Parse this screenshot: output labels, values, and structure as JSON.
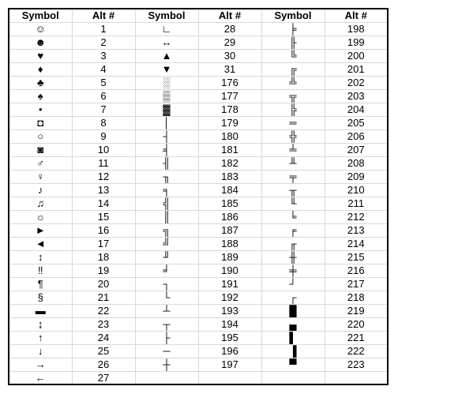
{
  "headers": [
    "Symbol",
    "Alt #",
    "Symbol",
    "Alt #",
    "Symbol",
    "Alt #"
  ],
  "columns": [
    [
      {
        "sym": "☺",
        "alt": "1"
      },
      {
        "sym": "☻",
        "alt": "2"
      },
      {
        "sym": "♥",
        "alt": "3"
      },
      {
        "sym": "♦",
        "alt": "4"
      },
      {
        "sym": "♣",
        "alt": "5"
      },
      {
        "sym": "♠",
        "alt": "6"
      },
      {
        "sym": "•",
        "alt": "7"
      },
      {
        "sym": "◘",
        "alt": "8"
      },
      {
        "sym": "○",
        "alt": "9"
      },
      {
        "sym": "◙",
        "alt": "10"
      },
      {
        "sym": "♂",
        "alt": "11"
      },
      {
        "sym": "♀",
        "alt": "12"
      },
      {
        "sym": "♪",
        "alt": "13"
      },
      {
        "sym": "♫",
        "alt": "14"
      },
      {
        "sym": "☼",
        "alt": "15"
      },
      {
        "sym": "►",
        "alt": "16"
      },
      {
        "sym": "◄",
        "alt": "17"
      },
      {
        "sym": "↕",
        "alt": "18"
      },
      {
        "sym": "‼",
        "alt": "19"
      },
      {
        "sym": "¶",
        "alt": "20"
      },
      {
        "sym": "§",
        "alt": "21"
      },
      {
        "sym": "▬",
        "alt": "22"
      },
      {
        "sym": "↨",
        "alt": "23"
      },
      {
        "sym": "↑",
        "alt": "24"
      },
      {
        "sym": "↓",
        "alt": "25"
      },
      {
        "sym": "→",
        "alt": "26"
      },
      {
        "sym": "←",
        "alt": "27"
      }
    ],
    [
      {
        "sym": "∟",
        "alt": "28"
      },
      {
        "sym": "↔",
        "alt": "29"
      },
      {
        "sym": "▲",
        "alt": "30"
      },
      {
        "sym": "▼",
        "alt": "31"
      },
      {
        "sym": "░",
        "alt": "176"
      },
      {
        "sym": "▒",
        "alt": "177"
      },
      {
        "sym": "▓",
        "alt": "178"
      },
      {
        "sym": "│",
        "alt": "179"
      },
      {
        "sym": "┤",
        "alt": "180"
      },
      {
        "sym": "╡",
        "alt": "181"
      },
      {
        "sym": "╢",
        "alt": "182"
      },
      {
        "sym": "╖",
        "alt": "183"
      },
      {
        "sym": "╕",
        "alt": "184"
      },
      {
        "sym": "╣",
        "alt": "185"
      },
      {
        "sym": "║",
        "alt": "186"
      },
      {
        "sym": "╗",
        "alt": "187"
      },
      {
        "sym": "╝",
        "alt": "188"
      },
      {
        "sym": "╜",
        "alt": "189"
      },
      {
        "sym": "╛",
        "alt": "190"
      },
      {
        "sym": "┐",
        "alt": "191"
      },
      {
        "sym": "└",
        "alt": "192"
      },
      {
        "sym": "┴",
        "alt": "193"
      },
      {
        "sym": "┬",
        "alt": "194"
      },
      {
        "sym": "├",
        "alt": "195"
      },
      {
        "sym": "─",
        "alt": "196"
      },
      {
        "sym": "┼",
        "alt": "197"
      },
      {
        "sym": "",
        "alt": ""
      }
    ],
    [
      {
        "sym": "╞",
        "alt": "198"
      },
      {
        "sym": "╟",
        "alt": "199"
      },
      {
        "sym": "╚",
        "alt": "200"
      },
      {
        "sym": "╔",
        "alt": "201"
      },
      {
        "sym": "╩",
        "alt": "202"
      },
      {
        "sym": "╦",
        "alt": "203"
      },
      {
        "sym": "╠",
        "alt": "204"
      },
      {
        "sym": "═",
        "alt": "205"
      },
      {
        "sym": "╬",
        "alt": "206"
      },
      {
        "sym": "╧",
        "alt": "207"
      },
      {
        "sym": "╨",
        "alt": "208"
      },
      {
        "sym": "╤",
        "alt": "209"
      },
      {
        "sym": "╥",
        "alt": "210"
      },
      {
        "sym": "╙",
        "alt": "211"
      },
      {
        "sym": "╘",
        "alt": "212"
      },
      {
        "sym": "╒",
        "alt": "213"
      },
      {
        "sym": "╓",
        "alt": "214"
      },
      {
        "sym": "╫",
        "alt": "215"
      },
      {
        "sym": "╪",
        "alt": "216"
      },
      {
        "sym": "┘",
        "alt": "217"
      },
      {
        "sym": "┌",
        "alt": "218"
      },
      {
        "sym": "█",
        "alt": "219"
      },
      {
        "sym": "▄",
        "alt": "220"
      },
      {
        "sym": "▌",
        "alt": "221"
      },
      {
        "sym": "▐",
        "alt": "222"
      },
      {
        "sym": "▀",
        "alt": "223"
      },
      {
        "sym": "",
        "alt": ""
      }
    ]
  ]
}
